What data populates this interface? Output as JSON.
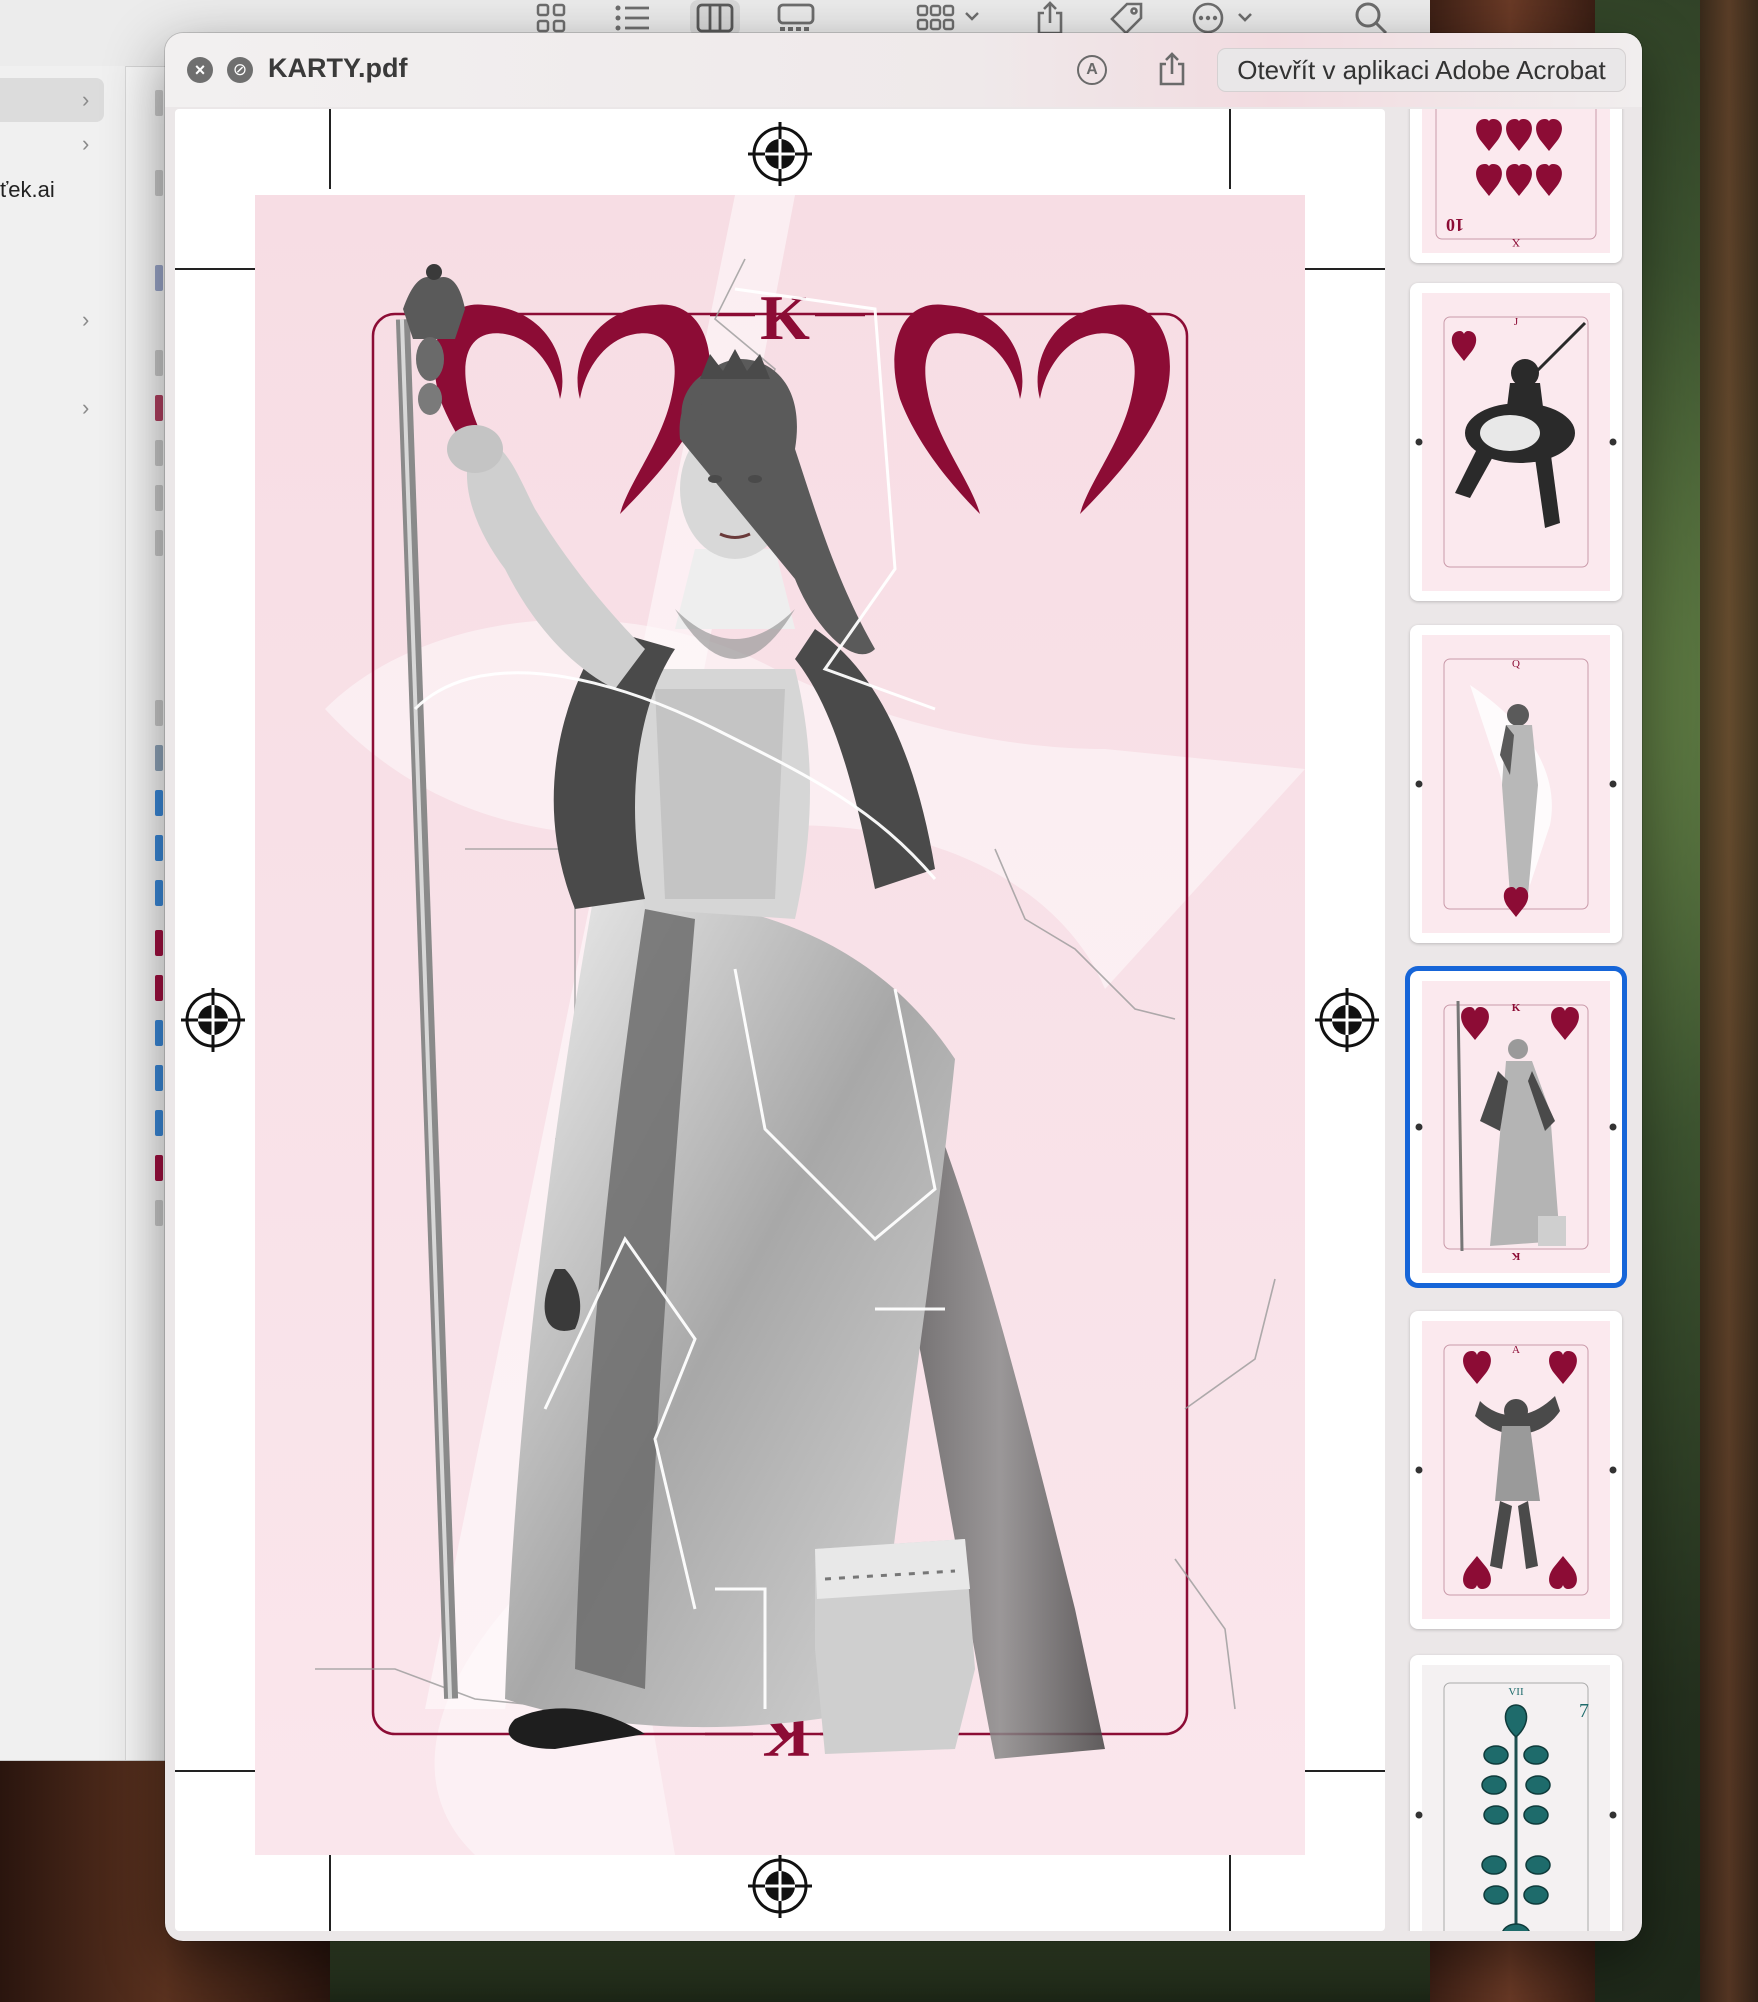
{
  "window": {
    "title": "KARTY.pdf",
    "open_button_label": "Otevřít v aplikaci Adobe Acrobat"
  },
  "finder": {
    "sidebar_file_fragment": "ťek.ai"
  },
  "card": {
    "rank_top": "K",
    "rank_bottom": "K",
    "suit": "hearts",
    "accent_color": "#8c0c35",
    "background_color": "#f8dfe6"
  },
  "thumbnails": [
    {
      "rank_label": "10",
      "rank_roman": "X",
      "suit": "hearts",
      "selected": false
    },
    {
      "rank_label": "J",
      "suit": "hearts",
      "selected": false
    },
    {
      "rank_label": "Q",
      "suit": "hearts",
      "selected": false
    },
    {
      "rank_label": "K",
      "suit": "hearts",
      "selected": true
    },
    {
      "rank_label": "A",
      "suit": "hearts",
      "selected": false
    },
    {
      "rank_label": "7",
      "rank_roman": "VII",
      "suit": "leaves",
      "selected": false
    }
  ],
  "icons": {
    "close": "close-icon",
    "fullscreen": "fullscreen-icon",
    "markup": "markup-icon",
    "share": "share-icon",
    "search": "search-icon"
  }
}
